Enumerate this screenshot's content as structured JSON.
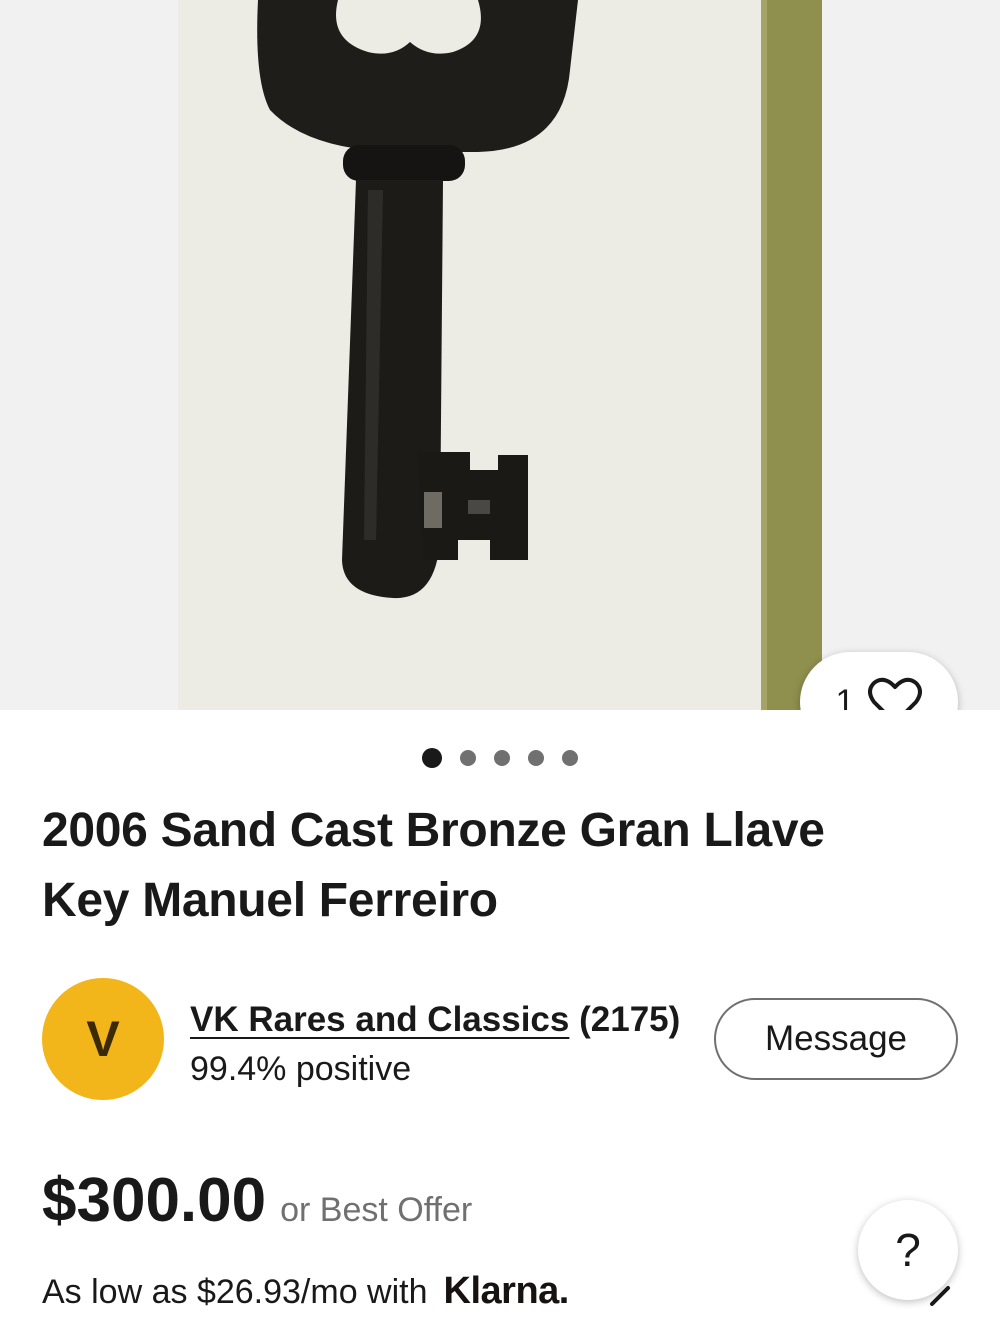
{
  "gallery": {
    "image_alt": "Bronze key on white background",
    "watch_count": "1",
    "pager": {
      "total": 5,
      "active_index": 0
    }
  },
  "listing": {
    "title_line1": "2006 Sand Cast Bronze Gran Llave",
    "title_line2": "Key Manuel Ferreiro"
  },
  "seller": {
    "initial": "V",
    "name": "VK Rares and Classics",
    "feedback_count": "(2175)",
    "feedback_percent": "99.4% positive",
    "avatar_color": "#f2b51a",
    "message_label": "Message"
  },
  "price": {
    "amount": "$300.00",
    "offer_text": "or Best Offer"
  },
  "financing": {
    "text": "As low as $26.93/mo with",
    "provider": "Klarna."
  },
  "help": {
    "label": "?"
  }
}
